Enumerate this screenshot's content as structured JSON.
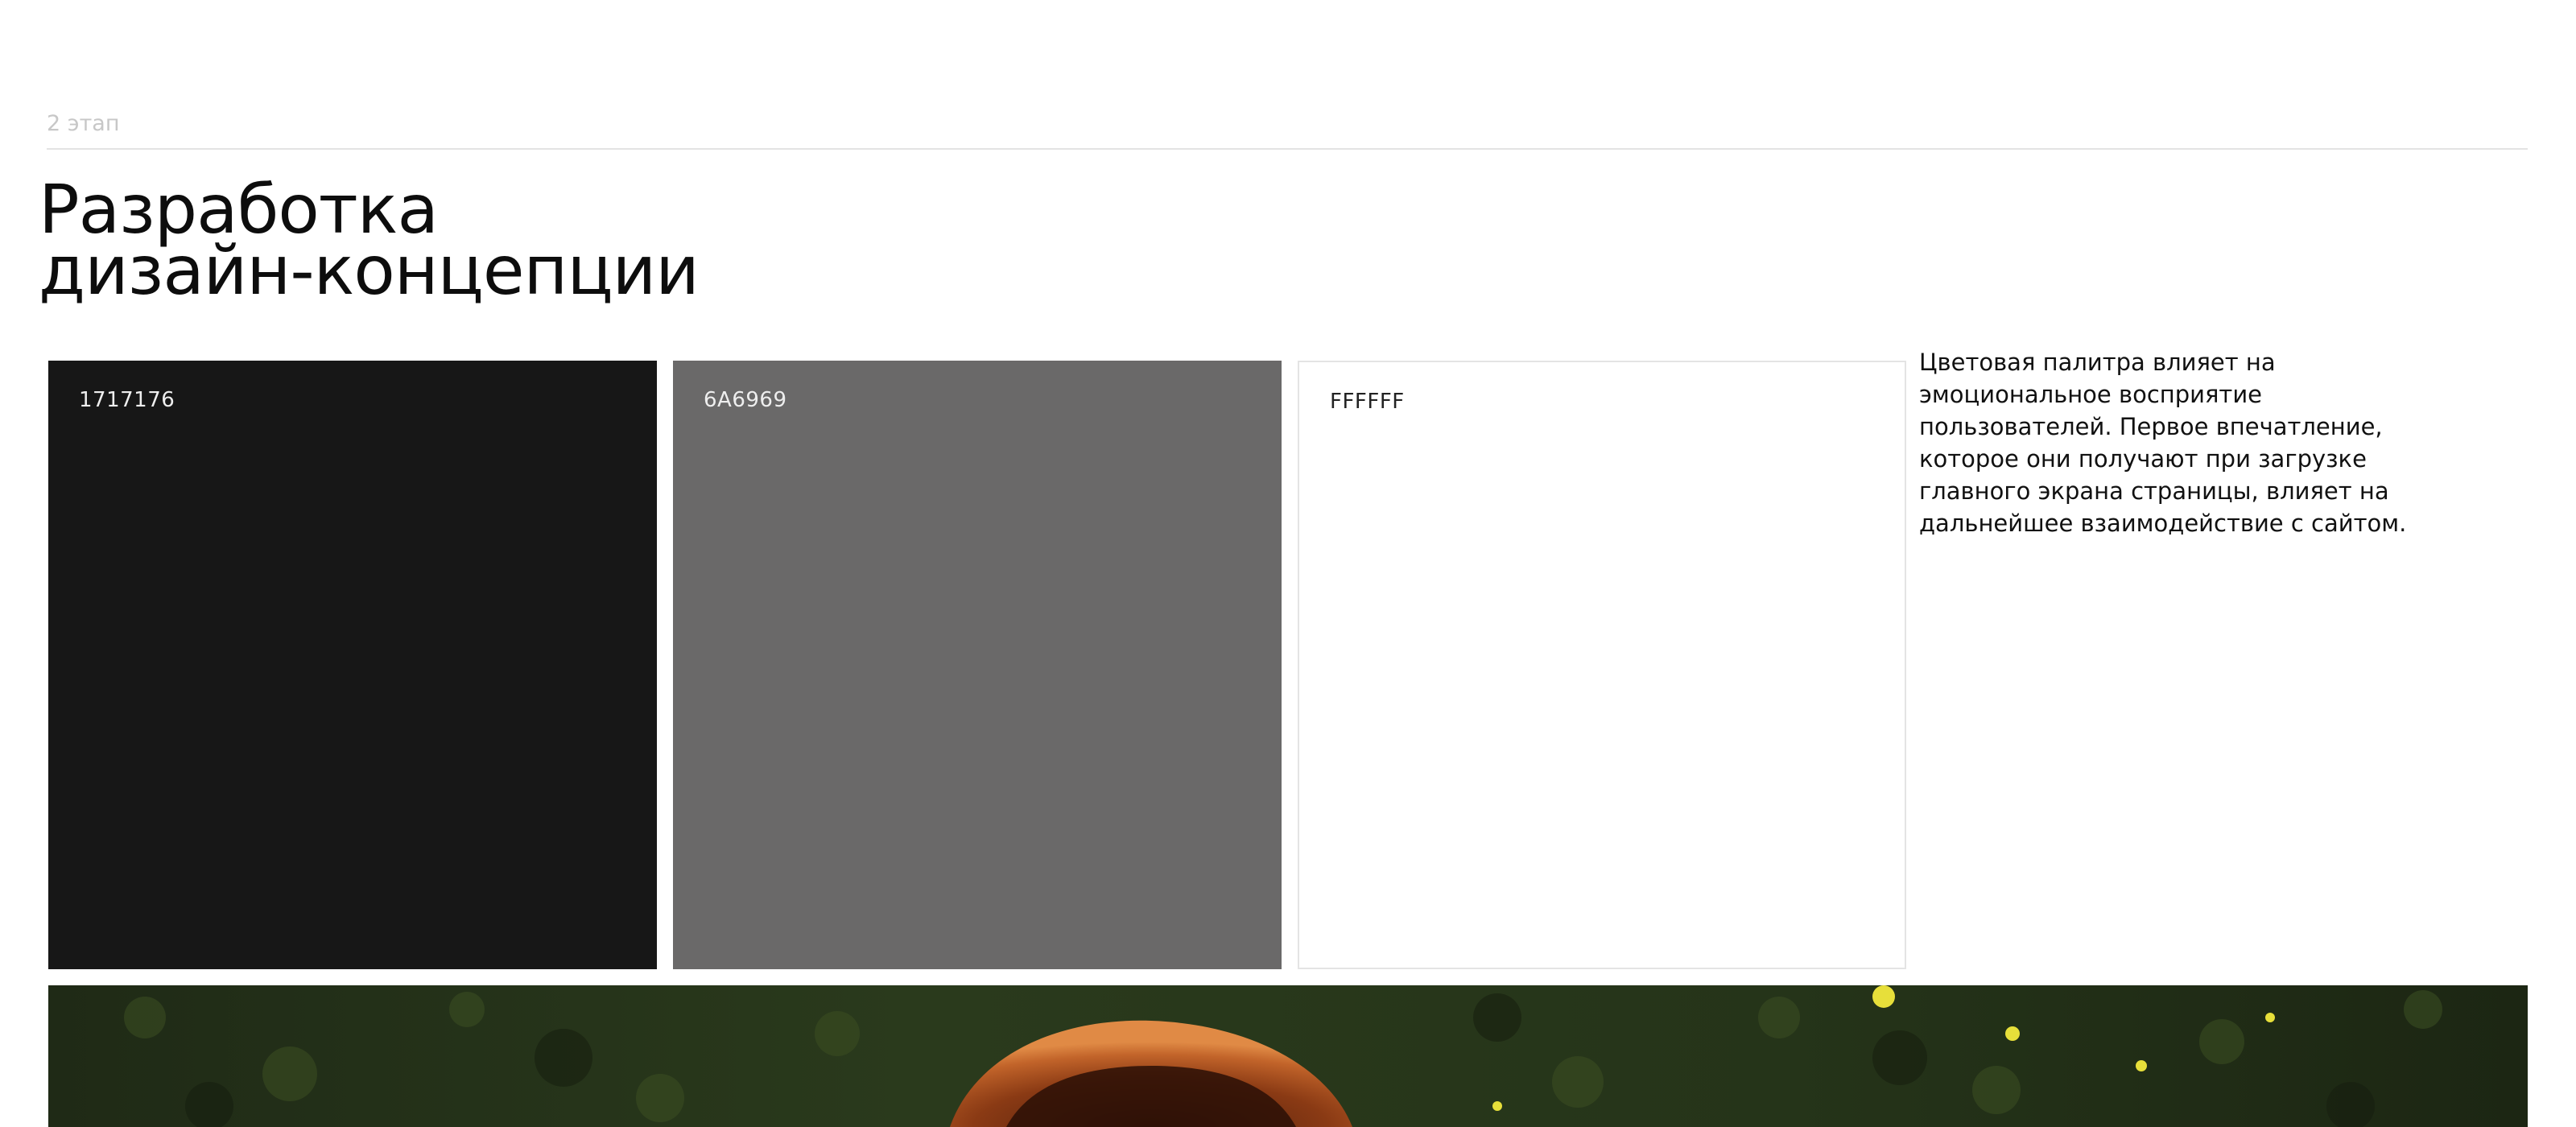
{
  "stage": {
    "label": "2 этап"
  },
  "heading": {
    "line1": "Разработка",
    "line2": "дизайн-концепции"
  },
  "palette": {
    "swatches": [
      {
        "code": "1717176",
        "color": "#171717"
      },
      {
        "code": "6A6969",
        "color": "#6A6969"
      },
      {
        "code": "FFFFFF",
        "color": "#FFFFFF"
      }
    ]
  },
  "description": {
    "text": "Цветовая палитра влияет на эмоциональное восприятие пользователей. Первое впечатление, которое они получают при загрузке главного экрана страницы, влияет на дальнейшее взаимодействие с сайтом."
  }
}
